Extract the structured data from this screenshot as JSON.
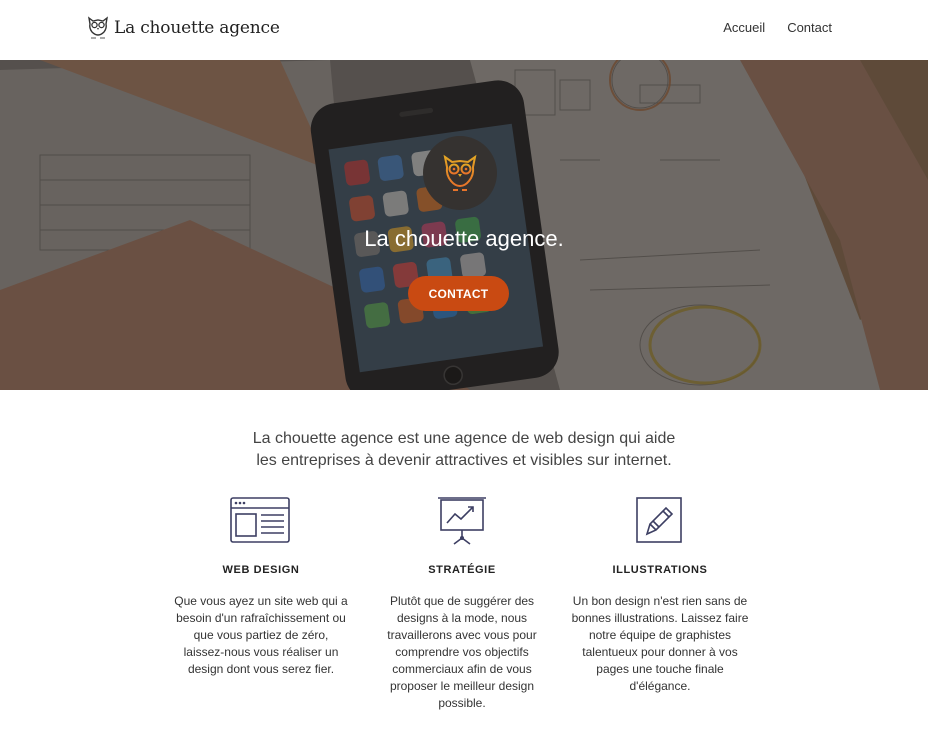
{
  "header": {
    "brand": "La chouette agence",
    "nav": [
      {
        "label": "Accueil"
      },
      {
        "label": "Contact"
      }
    ]
  },
  "hero": {
    "title": "La chouette agence.",
    "cta": "CONTACT"
  },
  "intro": {
    "lines": [
      "La chouette agence est une agence de web design qui aide",
      "les entreprises à devenir attractives et visibles sur internet."
    ]
  },
  "features": [
    {
      "icon": "browser-window-icon",
      "title": "WEB DESIGN",
      "lines": [
        "Que vous ayez un site web qui a",
        "besoin d'un rafraîchissement ou",
        "que vous partiez de zéro,",
        "laissez-nous vous réaliser un",
        "design dont vous serez fier."
      ]
    },
    {
      "icon": "presentation-chart-icon",
      "title": "STRATÉGIE",
      "lines": [
        "Plutôt que de suggérer des",
        "designs à la mode, nous",
        "travaillerons avec vous pour",
        "comprendre vos objectifs",
        "commerciaux afin de vous",
        "proposer le meilleur design",
        "possible."
      ]
    },
    {
      "icon": "pencil-edit-icon",
      "title": "ILLUSTRATIONS",
      "lines": [
        "Un bon design n'est rien sans de",
        "bonnes illustrations. Laissez faire",
        "notre équipe de graphistes",
        "talentueux pour donner à vos",
        "pages une touche finale",
        "d'élégance."
      ]
    }
  ],
  "colors": {
    "accent": "#c94a12",
    "icon_stroke": "#3d3f63",
    "logo_orange": "#e8742a",
    "logo_gold": "#e3a524"
  }
}
